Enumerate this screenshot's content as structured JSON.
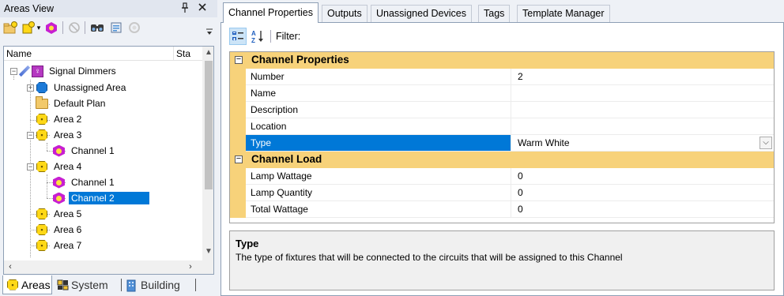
{
  "left_panel": {
    "title": "Areas View",
    "pin_glyph": "ᵖ",
    "close_glyph": "×",
    "toolbar": {
      "icons": [
        "add-area-icon",
        "add-area-dropdown-icon",
        "add-channel-icon",
        "disabled-icon",
        "find-icon",
        "details-icon",
        "refresh-icon",
        "menu-overflow-icon"
      ]
    },
    "tree": {
      "columns": [
        "Name",
        "Sta"
      ],
      "nodes": [
        {
          "label": "Signal Dimmers",
          "icon": "root-fixture-icon",
          "level": 0,
          "expander": "−"
        },
        {
          "label": "Unassigned Area",
          "icon": "unassigned-area-icon",
          "level": 1,
          "expander": "+"
        },
        {
          "label": "Default Plan",
          "icon": "folder-icon",
          "level": 1,
          "expander": ""
        },
        {
          "label": "Area 2",
          "icon": "area-icon",
          "level": 1,
          "expander": ""
        },
        {
          "label": "Area 3",
          "icon": "area-icon",
          "level": 1,
          "expander": "−"
        },
        {
          "label": "Channel 1",
          "icon": "channel-icon",
          "level": 2,
          "expander": ""
        },
        {
          "label": "Area 4",
          "icon": "area-icon",
          "level": 1,
          "expander": "−"
        },
        {
          "label": "Channel 1",
          "icon": "channel-icon",
          "level": 2,
          "expander": ""
        },
        {
          "label": "Channel 2",
          "icon": "channel-icon",
          "level": 2,
          "expander": "",
          "selected": true
        },
        {
          "label": "Area 5",
          "icon": "area-icon",
          "level": 1,
          "expander": ""
        },
        {
          "label": "Area 6",
          "icon": "area-icon",
          "level": 1,
          "expander": ""
        },
        {
          "label": "Area 7",
          "icon": "area-icon",
          "level": 1,
          "expander": ""
        }
      ]
    },
    "bottom_tabs": [
      {
        "label": "Areas",
        "icon": "area-icon",
        "active": true
      },
      {
        "label": "System",
        "icon": "system-icon",
        "active": false
      },
      {
        "label": "Building",
        "icon": "building-icon",
        "active": false
      }
    ]
  },
  "tabs": [
    "Channel Properties",
    "Outputs",
    "Unassigned Devices",
    "Tags",
    "Template Manager"
  ],
  "active_tab": "Channel Properties",
  "properties": {
    "filter_label": "Filter:",
    "filter_value": "",
    "categories": [
      {
        "name": "Channel Properties",
        "rows": [
          {
            "name": "Number",
            "value": "2"
          },
          {
            "name": "Name",
            "value": ""
          },
          {
            "name": "Description",
            "value": ""
          },
          {
            "name": "Location",
            "value": ""
          },
          {
            "name": "Type",
            "value": "Warm White",
            "selected": true,
            "dropdown": true
          }
        ]
      },
      {
        "name": "Channel Load",
        "rows": [
          {
            "name": "Lamp Wattage",
            "value": "0"
          },
          {
            "name": "Lamp Quantity",
            "value": "0"
          },
          {
            "name": "Total Wattage",
            "value": "0"
          }
        ]
      }
    ],
    "help": {
      "title": "Type",
      "description": "The type of fixtures that will be connected to the circuits that will be assigned to this Channel"
    }
  },
  "colors": {
    "category_bg": "#f7d27a",
    "selection": "#0078d7",
    "panel_bg": "#eef1f6"
  }
}
